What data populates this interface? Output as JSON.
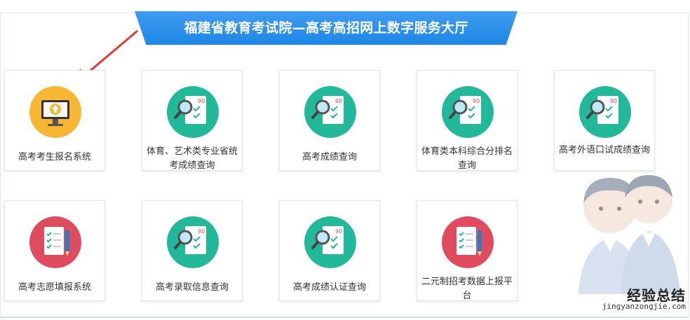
{
  "header": {
    "title": "福建省教育考试院—高考高招网上数字服务大厅"
  },
  "services": [
    {
      "label": "高考考生报名系统",
      "icon": "computer-upload-icon"
    },
    {
      "label": "体育、艺术类专业省统考成绩查询",
      "icon": "exam-paper-magnifier-icon"
    },
    {
      "label": "高考成绩查询",
      "icon": "exam-paper-magnifier-icon"
    },
    {
      "label": "体育类本科综合分排名查询",
      "icon": "exam-paper-magnifier-icon"
    },
    {
      "label": "高考外语口试成绩查询",
      "icon": "exam-paper-magnifier-icon"
    },
    {
      "label": "高考志愿填报系统",
      "icon": "checklist-pencil-icon"
    },
    {
      "label": "高考录取信息查询",
      "icon": "exam-paper-magnifier-icon"
    },
    {
      "label": "高考成绩认证查询",
      "icon": "exam-paper-magnifier-icon"
    },
    {
      "label": "二元制招考数据上报平台",
      "icon": "checklist-pencil-icon"
    }
  ],
  "watermark": {
    "text": "经验总结",
    "url": "jingyanzongjie.com"
  },
  "colors": {
    "banner": "#2b8fe9",
    "teal": "#22b99a",
    "orange": "#f7b733",
    "red": "#e04b5e",
    "annotation_arrow": "#e53935"
  }
}
